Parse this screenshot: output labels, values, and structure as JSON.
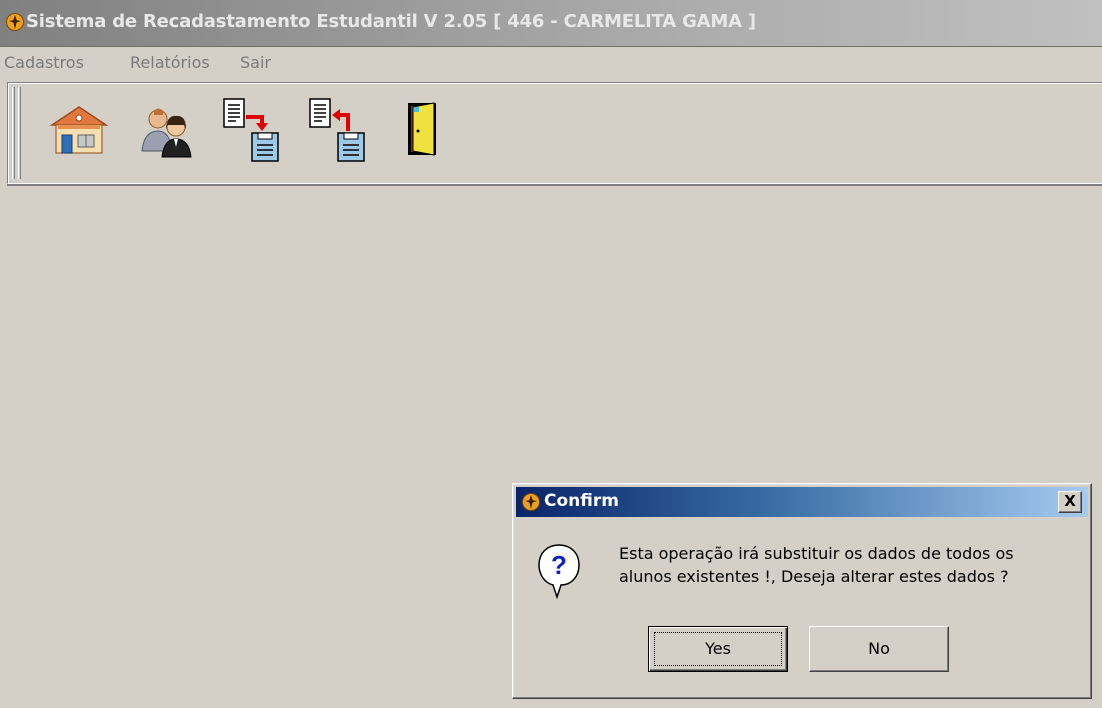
{
  "window": {
    "title": "Sistema de Recadastamento Estudantil V 2.05 [ 446 - CARMELITA GAMA ]",
    "icon": "app-compass-icon"
  },
  "menu": {
    "items": [
      {
        "label": "Cadastros"
      },
      {
        "label": "Relatórios"
      },
      {
        "label": "Sair"
      }
    ]
  },
  "toolbar": {
    "buttons": [
      {
        "icon": "school-house-icon"
      },
      {
        "icon": "users-icon"
      },
      {
        "icon": "export-data-icon"
      },
      {
        "icon": "import-data-icon"
      },
      {
        "icon": "exit-door-icon"
      }
    ]
  },
  "dialog": {
    "title": "Confirm",
    "close_label": "X",
    "icon": "question-icon",
    "message_line1": "Esta operação irá substituir os dados de todos os",
    "message_line2": "alunos existentes !, Deseja alterar estes dados ?",
    "yes_label": "Yes",
    "no_label": "No"
  },
  "colors": {
    "desktop_bg": "#d4d0c8",
    "active_title_start": "#0a246a",
    "active_title_end": "#a6caf0",
    "inactive_title": "#808080"
  }
}
